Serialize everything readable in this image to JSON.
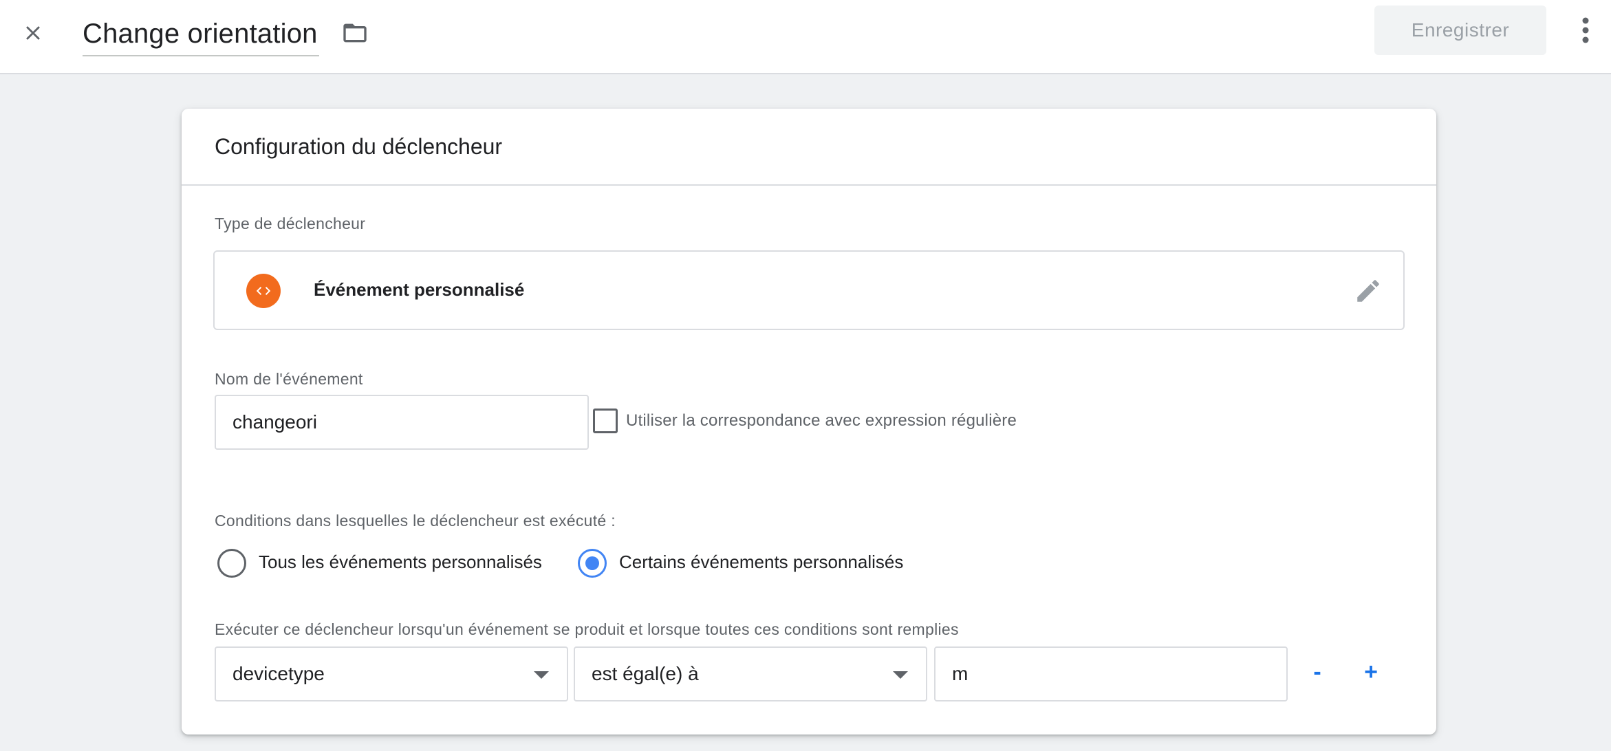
{
  "header": {
    "title": "Change orientation",
    "save_label": "Enregistrer"
  },
  "card": {
    "title": "Configuration du déclencheur",
    "trigger_type_label": "Type de déclencheur",
    "trigger_type_value": "Événement personnalisé",
    "trigger_type_icon": "custom-event-code-icon",
    "event_name_label": "Nom de l'événement",
    "event_name_value": "changeori",
    "regex_checkbox_label": "Utiliser la correspondance avec expression régulière",
    "regex_checked": false,
    "conditions_label": "Conditions dans lesquelles le déclencheur est exécuté :",
    "radio_all_label": "Tous les événements personnalisés",
    "radio_some_label": "Certains événements personnalisés",
    "selected_radio": "some",
    "filter_label": "Exécuter ce déclencheur lorsqu'un événement se produit et lorsque toutes ces conditions sont remplies",
    "filter": {
      "variable": "devicetype",
      "operator": "est égal(e) à",
      "value": "m"
    },
    "remove_label": "-",
    "add_label": "+"
  },
  "colors": {
    "accent": "#1a73e8",
    "radio_selected": "#4285f4",
    "trigger_icon_bg": "#f26b1d"
  }
}
